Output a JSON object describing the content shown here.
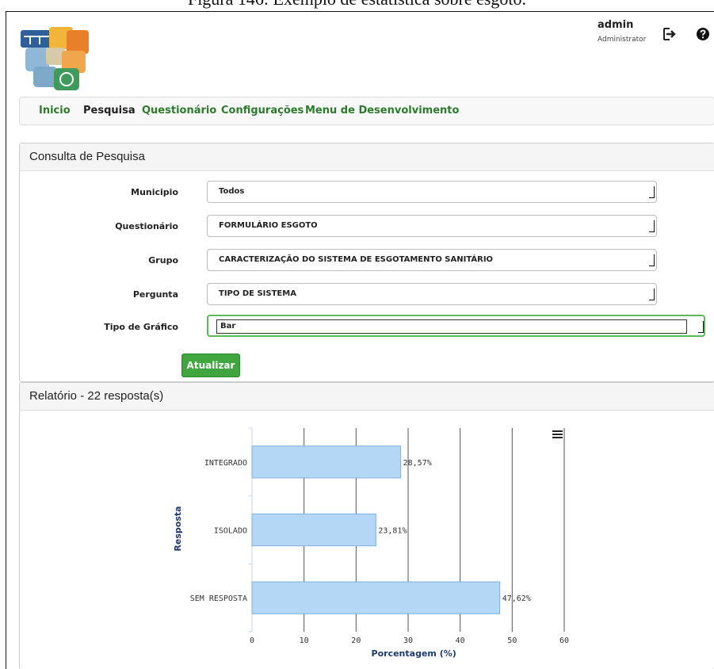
{
  "caption": "Figura 146: Exemplo de estatística sobre esgoto.",
  "header": {
    "user_name": "admin",
    "user_role": "Administrator",
    "logout_icon": "sign-out-icon",
    "help_icon": "question-circle-icon"
  },
  "nav": {
    "items": [
      {
        "label": "Inicio"
      },
      {
        "label": "Pesquisa"
      },
      {
        "label": "Questionário"
      },
      {
        "label": "Configurações"
      },
      {
        "label": "Menu de Desenvolvimento"
      }
    ]
  },
  "query": {
    "title": "Consulta de Pesquisa",
    "fields": [
      {
        "label": "Municipio",
        "value": "Todos"
      },
      {
        "label": "Questionário",
        "value": "FORMULÁRIO ESGOTO"
      },
      {
        "label": "Grupo",
        "value": "CARACTERIZAÇÃO DO SISTEMA DE ESGOTAMENTO SANITÁRIO"
      },
      {
        "label": "Pergunta",
        "value": "TIPO DE SISTEMA"
      },
      {
        "label": "Tipo de Gráfico",
        "value": "Bar"
      }
    ],
    "update_label": "Atualizar"
  },
  "report": {
    "title": "Relatório - 22 resposta(s)",
    "menu_icon": "hamburger-menu-icon"
  },
  "chart_data": {
    "type": "bar",
    "orientation": "horizontal",
    "categories": [
      "INTEGRADO",
      "ISOLADO",
      "SEM RESPOSTA"
    ],
    "values": [
      28.57,
      23.81,
      47.62
    ],
    "data_labels": [
      "28,57%",
      "23,81%",
      "47,62%"
    ],
    "xlabel": "Porcentagem (%)",
    "ylabel": "Resposta",
    "xlim": [
      0,
      60
    ],
    "xticks": [
      "0",
      "10",
      "20",
      "30",
      "40",
      "50",
      "60"
    ],
    "grid": true,
    "bar_color": "#b3d7f5",
    "bar_border": "#7fb1e0",
    "axis_title_color": "#1f3a6e"
  }
}
